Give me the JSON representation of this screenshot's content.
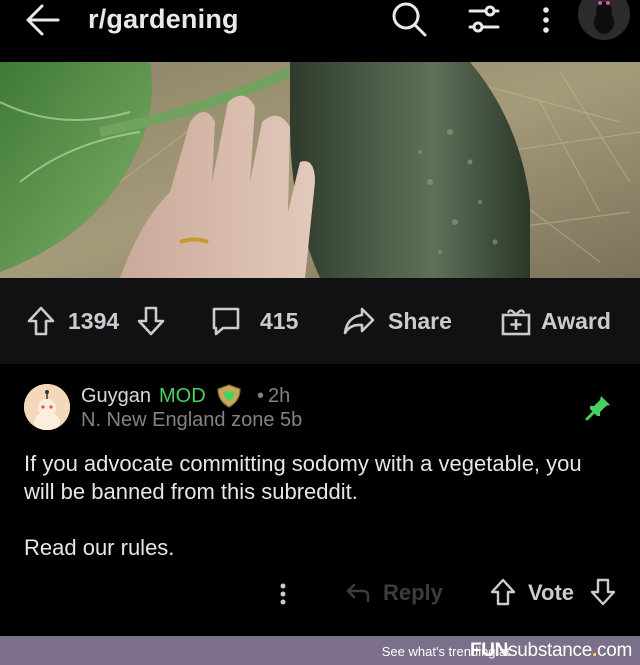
{
  "header": {
    "title": "r/gardening",
    "icons": [
      "back-arrow-icon",
      "search-icon",
      "filter-icon",
      "more-vertical-icon",
      "user-avatar"
    ]
  },
  "post": {
    "image_alt": "zucchini",
    "upvotes": "1394",
    "comments": "415",
    "share_label": "Share",
    "award_label": "Award"
  },
  "comment": {
    "author": "Guygan",
    "mod_label": "MOD",
    "dot": "•",
    "time": "2h",
    "flair": "N. New England zone 5b",
    "body_line1": "If you advocate committing sodomy with a vegetable, you will be banned from this subreddit.",
    "body_line2": "Read our rules.",
    "reply_label": "Reply",
    "vote_label": "Vote"
  },
  "watermark": {
    "text": "See what's trending at",
    "logo_fun": "FUN",
    "logo_sub": "substance",
    "logo_dot": ".",
    "logo_com": "com"
  },
  "colors": {
    "background": "#000000",
    "action_bar": "#111113",
    "mod_green": "#46d160",
    "pin_green": "#46d160",
    "muted": "#818384",
    "watermark_bg": "#7b6f8a"
  }
}
